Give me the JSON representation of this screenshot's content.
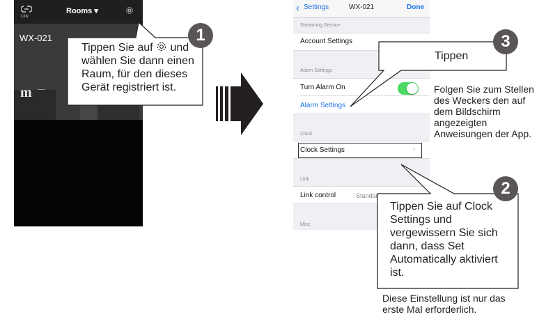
{
  "left_phone": {
    "link_label": "Link",
    "rooms_label": "Rooms ▾",
    "device_name": "WX-021",
    "logo_text": "m"
  },
  "right_phone": {
    "back_label": "Settings",
    "title": "WX-021",
    "done_label": "Done",
    "sections": {
      "streaming": "Streaming Service",
      "alarm": "Alarm Settings",
      "clock": "Clock",
      "link": "Link",
      "misc": "Misc."
    },
    "cells": {
      "account_settings": "Account Settings",
      "turn_alarm_on": "Turn Alarm On",
      "alarm_settings": "Alarm Settings",
      "clock_settings": "Clock Settings",
      "link_control": "Link control",
      "link_control_value": "Standar"
    },
    "alarm_toggle_on": true
  },
  "callouts": {
    "one": {
      "badge": "1",
      "text_before_icon": "Tippen Sie auf",
      "text_after": "und wählen Sie dann einen Raum, für den dieses Gerät registriert ist."
    },
    "two": {
      "badge": "2",
      "text": "Tippen Sie auf Clock Settings und vergewissern Sie sich dann, dass Set Automatically aktiviert ist."
    },
    "three": {
      "badge": "3",
      "text": "Tippen"
    }
  },
  "notes": {
    "alarm_note": "Folgen Sie zum Stellen des Weckers den auf dem Bildschirm angezeigten Anweisungen der App.",
    "first_time_note": "Diese Einstellung ist nur das erste Mal erforderlich."
  },
  "colors": {
    "badge": "#5a5657",
    "ios_blue": "#1a73e8",
    "toggle_on": "#4cd964"
  },
  "icons": [
    "link-icon",
    "gear-icon",
    "chevron-left-icon",
    "chevron-right-icon",
    "arrow-right-icon"
  ]
}
